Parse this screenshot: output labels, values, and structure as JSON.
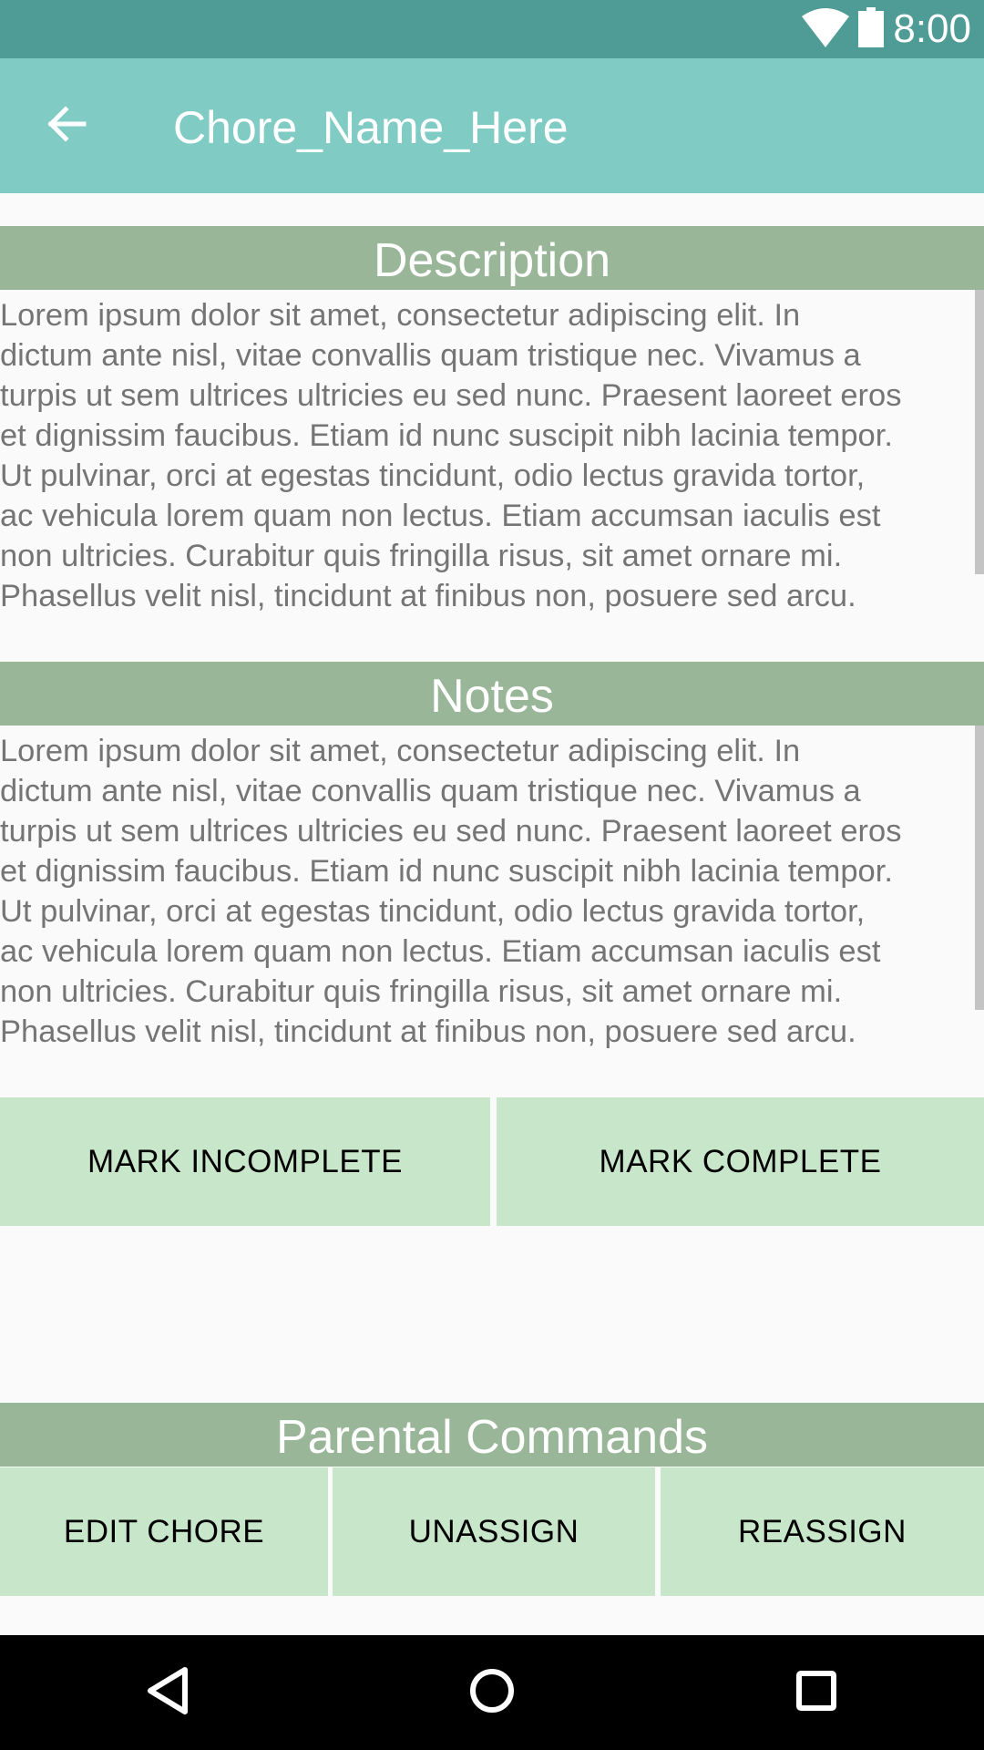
{
  "status_bar": {
    "time": "8:00",
    "icons": [
      "wifi-icon",
      "battery-icon"
    ]
  },
  "app_bar": {
    "back_icon": "arrow-back-icon",
    "title": "Chore_Name_Here"
  },
  "description": {
    "header": "Description",
    "lines": [
      "Lorem ipsum dolor sit amet, consectetur adipiscing elit. In",
      "dictum ante nisl, vitae convallis quam tristique nec. Vivamus a",
      "turpis ut sem ultrices ultricies eu sed nunc. Praesent laoreet eros",
      "et dignissim faucibus. Etiam id nunc suscipit nibh lacinia tempor.",
      "Ut pulvinar, orci at egestas tincidunt, odio lectus gravida tortor,",
      "ac vehicula lorem quam non lectus. Etiam accumsan iaculis est",
      "non ultricies. Curabitur quis fringilla risus, sit amet ornare mi.",
      "Phasellus velit nisl, tincidunt at finibus non, posuere sed arcu."
    ]
  },
  "notes": {
    "header": "Notes",
    "lines": [
      "Lorem ipsum dolor sit amet, consectetur adipiscing elit. In",
      "dictum ante nisl, vitae convallis quam tristique nec. Vivamus a",
      "turpis ut sem ultrices ultricies eu sed nunc. Praesent laoreet eros",
      "et dignissim faucibus. Etiam id nunc suscipit nibh lacinia tempor.",
      "Ut pulvinar, orci at egestas tincidunt, odio lectus gravida tortor,",
      "ac vehicula lorem quam non lectus. Etiam accumsan iaculis est",
      "non ultricies. Curabitur quis fringilla risus, sit amet ornare mi.",
      "Phasellus velit nisl, tincidunt at finibus non, posuere sed arcu."
    ]
  },
  "status_buttons": {
    "mark_incomplete": "MARK INCOMPLETE",
    "mark_complete": "MARK COMPLETE"
  },
  "parental": {
    "header": "Parental Commands",
    "edit_chore": "EDIT CHORE",
    "unassign": "UNASSIGN",
    "reassign": "REASSIGN"
  },
  "nav_bar": {
    "icons": [
      "back-triangle-icon",
      "home-circle-icon",
      "recents-square-icon"
    ]
  },
  "colors": {
    "status_bar": "#4f9b95",
    "app_bar": "#80cbc4",
    "section_header": "#99b698",
    "button": "#c8e6c9",
    "background": "#fafafa"
  }
}
